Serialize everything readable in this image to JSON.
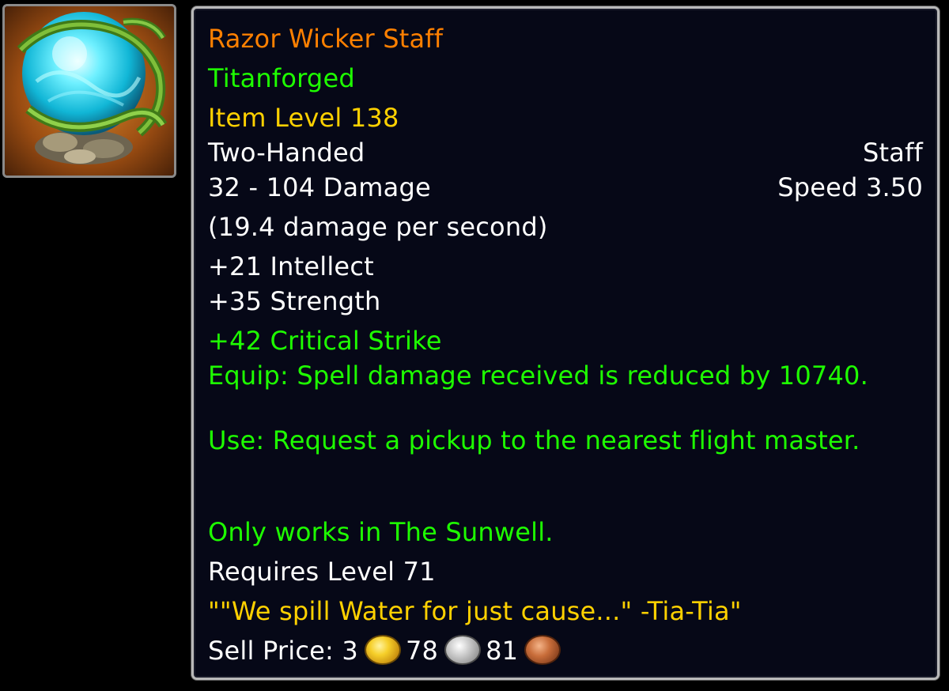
{
  "icon": {
    "name": "razor-wicker-staff-icon"
  },
  "item": {
    "name": "Razor Wicker Staff",
    "tag": "Titanforged",
    "item_level": "Item Level 138",
    "slot": "Two-Handed",
    "type": "Staff",
    "damage": "32 - 104 Damage",
    "speed": "Speed 3.50",
    "dps": "(19.4 damage per second)",
    "stats": [
      "+21 Intellect",
      "+35 Strength"
    ],
    "secondary_stat": "+42 Critical Strike",
    "equip": "Equip: Spell damage received is reduced by 10740.",
    "use": "Use: Request a pickup to the nearest flight master.",
    "restriction": "Only works in The Sunwell.",
    "requires": "Requires Level 71",
    "flavor": "\"\"We spill Water for just cause...\" -Tia-Tia\"",
    "sell_price": {
      "label": "Sell Price:",
      "gold": "3",
      "silver": "78",
      "copper": "81"
    }
  },
  "colors": {
    "name": "#ff8000",
    "green": "#1eff00",
    "yellow": "#ffd100",
    "white": "#ffffff",
    "background": "#060817",
    "border": "#b9b9b9"
  }
}
